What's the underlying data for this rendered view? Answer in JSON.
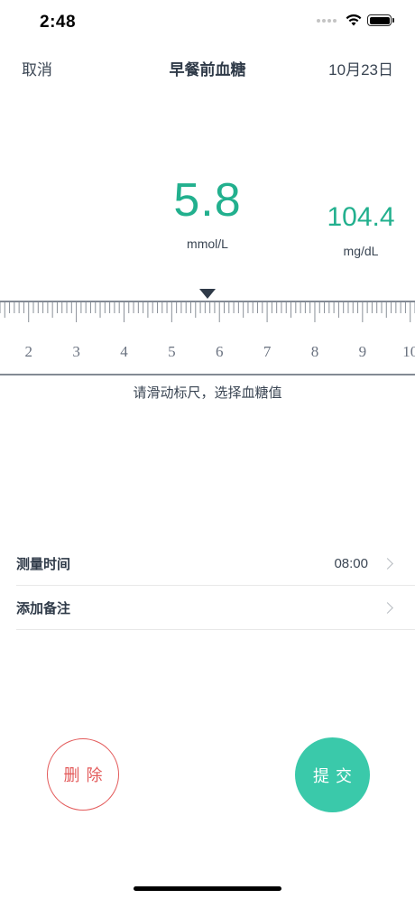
{
  "status_bar": {
    "time": "2:48",
    "icons": [
      "signal-dots-icon",
      "wifi-icon",
      "battery-icon"
    ]
  },
  "nav": {
    "cancel_label": "取消",
    "title": "早餐前血糖",
    "date": "10月23日"
  },
  "reading": {
    "mmol_value": "5.8",
    "mmol_unit": "mmol/L",
    "mgdl_value": "104.4",
    "mgdl_unit": "mg/dL",
    "color": "#22b08e"
  },
  "ruler": {
    "min": 1.4,
    "max": 10.1,
    "selected": 5.8,
    "step": 0.1,
    "labels": [
      "2",
      "3",
      "4",
      "5",
      "6",
      "7",
      "8",
      "9",
      "10"
    ],
    "hint": "请滑动标尺，选择血糖值"
  },
  "settings": {
    "measure_time_label": "测量时间",
    "measure_time_value": "08:00",
    "add_note_label": "添加备注"
  },
  "actions": {
    "delete_label": "删除",
    "submit_label": "提交",
    "delete_color": "#e35a5a",
    "submit_color": "#3ac9aa"
  }
}
